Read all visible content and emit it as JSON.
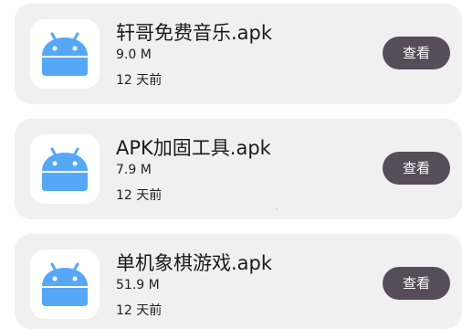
{
  "files": [
    {
      "name": "轩哥免费音乐.apk",
      "size": "9.0 M",
      "date": "12 天前",
      "action": "查看",
      "icon": "android-icon"
    },
    {
      "name": "APK加固工具.apk",
      "size": "7.9 M",
      "date": "12 天前",
      "action": "查看",
      "icon": "android-icon"
    },
    {
      "name": "单机象棋游戏.apk",
      "size": "51.9 M",
      "date": "12 天前",
      "action": "查看",
      "icon": "android-icon"
    }
  ],
  "colors": {
    "card_background": "#f0f0f0",
    "button_background": "#564c5a",
    "icon_color": "#56a8f6"
  }
}
